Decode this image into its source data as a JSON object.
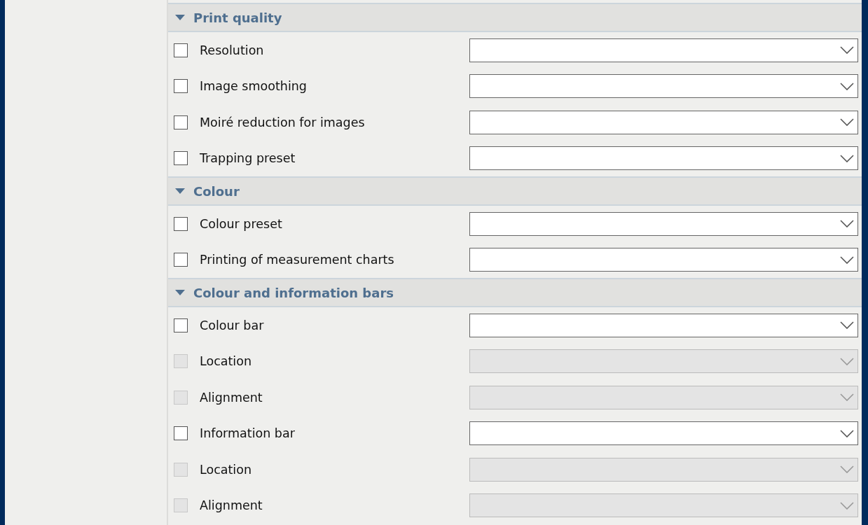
{
  "sections": [
    {
      "title": "Print quality",
      "expanded": true,
      "rows": [
        {
          "label": "Resolution",
          "checked": false,
          "disabled": false
        },
        {
          "label": "Image smoothing",
          "checked": false,
          "disabled": false
        },
        {
          "label": "Moiré reduction for images",
          "checked": false,
          "disabled": false
        },
        {
          "label": "Trapping preset",
          "checked": false,
          "disabled": false
        }
      ]
    },
    {
      "title": "Colour",
      "expanded": true,
      "rows": [
        {
          "label": "Colour preset",
          "checked": false,
          "disabled": false
        },
        {
          "label": "Printing of measurement charts",
          "checked": false,
          "disabled": false
        }
      ]
    },
    {
      "title": "Colour and information bars",
      "expanded": true,
      "rows": [
        {
          "label": "Colour bar",
          "checked": false,
          "disabled": false
        },
        {
          "label": "Location",
          "checked": false,
          "disabled": true
        },
        {
          "label": "Alignment",
          "checked": false,
          "disabled": true
        },
        {
          "label": "Information bar",
          "checked": false,
          "disabled": false
        },
        {
          "label": "Location",
          "checked": false,
          "disabled": true
        },
        {
          "label": "Alignment",
          "checked": false,
          "disabled": true
        }
      ]
    }
  ]
}
